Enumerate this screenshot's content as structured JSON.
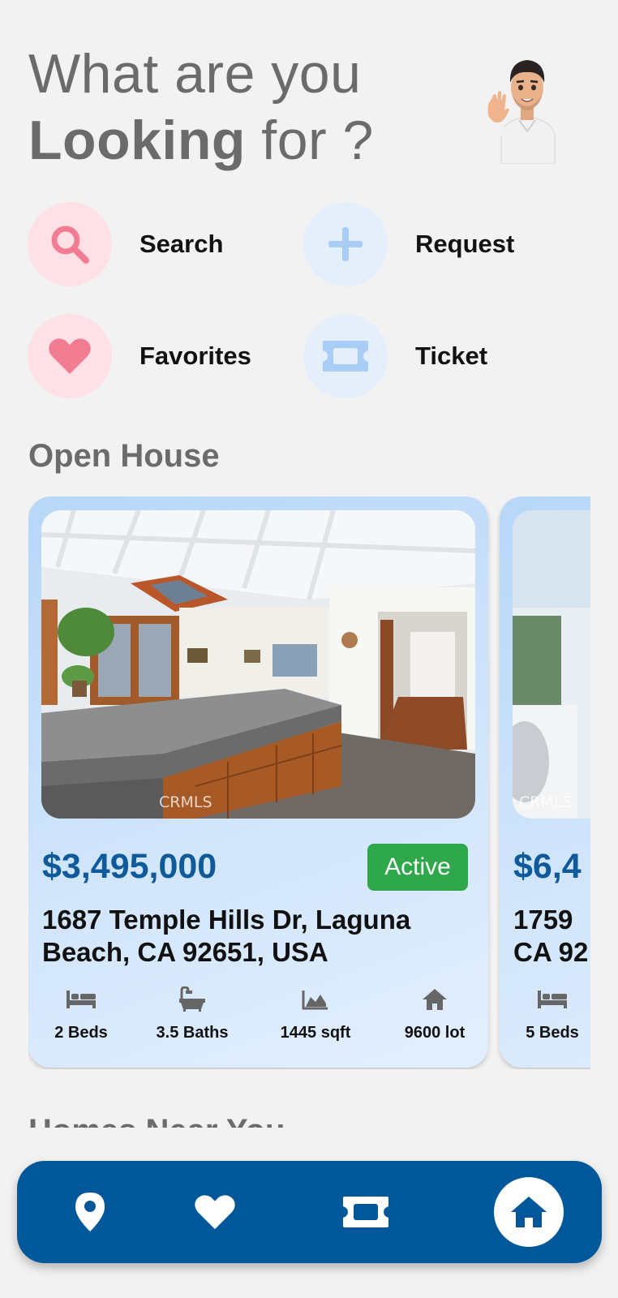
{
  "header": {
    "line1": "What are you",
    "line2_bold": "Looking",
    "line2_rest": " for ?"
  },
  "actions": [
    {
      "label": "Search",
      "icon": "search-icon",
      "color": "#f27d92"
    },
    {
      "label": "Request",
      "icon": "plus-icon",
      "color": "#a9cdf5"
    },
    {
      "label": "Favorites",
      "icon": "heart-icon",
      "color": "#f27d92"
    },
    {
      "label": "Ticket",
      "icon": "ticket-icon",
      "color": "#a9cdf5"
    }
  ],
  "open_house": {
    "title": "Open House",
    "listings": [
      {
        "photo_watermark": "CRMLS",
        "price": "$3,495,000",
        "status": "Active",
        "address": "1687 Temple Hills Dr, Laguna Beach, CA 92651, USA",
        "beds": "2 Beds",
        "baths": "3.5 Baths",
        "sqft": "1445 sqft",
        "lot": "9600 lot"
      },
      {
        "photo_watermark": "CRMLS",
        "price": "$6,4",
        "address": "1759\nCA 92",
        "beds": "5 Beds"
      }
    ]
  },
  "next_section": {
    "title": "Homes Near You"
  },
  "nav": {
    "items": [
      "map-pin-icon",
      "heart-icon",
      "ticket-icon",
      "home-icon"
    ],
    "active": "home-icon",
    "bar_color": "#00579a"
  }
}
